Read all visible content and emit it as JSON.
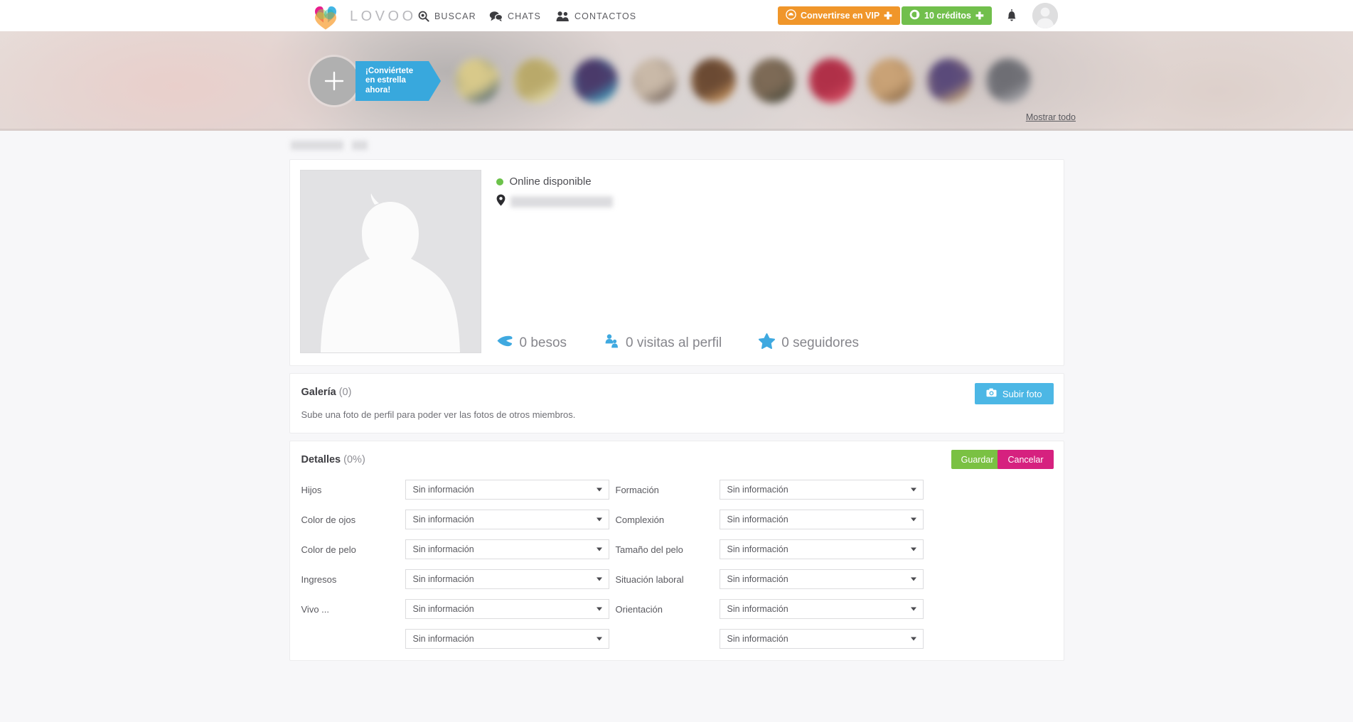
{
  "header": {
    "brand": "LOVOO",
    "nav": [
      {
        "label": "BUSCAR",
        "icon": "search-icon"
      },
      {
        "label": "CHATS",
        "icon": "chat-bubbles-icon"
      },
      {
        "label": "CONTACTOS",
        "icon": "contacts-icon"
      }
    ],
    "vip_button": {
      "label": "Convertirse en VIP",
      "plus": "✚",
      "color": "#f0962a"
    },
    "credits_button": {
      "label": "10 créditos",
      "plus": "✚",
      "color": "#71bf4c",
      "credits": 10
    },
    "bell_icon": "notification-bell-icon",
    "avatar_icon": "user-avatar-placeholder"
  },
  "banner": {
    "star_cta": {
      "line1": "¡Conviértete",
      "line2": "en estrella",
      "line3": "ahora!",
      "plus": "+"
    },
    "show_all_link": "Mostrar todo",
    "avatars": [
      {
        "c1": "#2f4f6e",
        "c2": "#d8c98a"
      },
      {
        "c1": "#efe9c0",
        "c2": "#b9a96a"
      },
      {
        "c1": "#3fbfd8",
        "c2": "#4a3a6a"
      },
      {
        "c1": "#5a4b44",
        "c2": "#c9b9a8"
      },
      {
        "c1": "#e0a86a",
        "c2": "#6b4a33"
      },
      {
        "c1": "#3b4034",
        "c2": "#7d6a56"
      },
      {
        "c1": "#e0566a",
        "c2": "#b03048"
      },
      {
        "c1": "#7a5a3a",
        "c2": "#c9a276"
      },
      {
        "c1": "#e8c37a",
        "c2": "#5a4a7a"
      },
      {
        "c1": "#b9b9bd",
        "c2": "#6e6e74"
      }
    ]
  },
  "profile": {
    "name_redacted": true,
    "age_redacted": true,
    "status": "Online disponible",
    "status_color": "#6cc24a",
    "location_redacted": true,
    "avatar_placeholder": "person-silhouette-icon",
    "stats": [
      {
        "icon": "kiss-lips-icon",
        "label": "0 besos",
        "value": 0
      },
      {
        "icon": "profile-visits-icon",
        "label": "0 visitas al perfil",
        "value": 0
      },
      {
        "icon": "star-icon",
        "label": "0 seguidores",
        "value": 0
      }
    ]
  },
  "gallery": {
    "title": "Galería",
    "count": "(0)",
    "hint": "Sube una foto de perfil para poder ver las fotos de otros miembros.",
    "upload_button": "Subir foto",
    "upload_icon": "camera-icon"
  },
  "details": {
    "title": "Detalles",
    "percent": "(0%)",
    "save_button": "Guardar",
    "cancel_button": "Cancelar",
    "placeholder_value": "Sin información",
    "fields": [
      {
        "label": "Hijos",
        "value": "Sin información"
      },
      {
        "label": "Formación",
        "value": "Sin información"
      },
      {
        "label": "Color de ojos",
        "value": "Sin información"
      },
      {
        "label": "Complexión",
        "value": "Sin información"
      },
      {
        "label": "Color de pelo",
        "value": "Sin información"
      },
      {
        "label": "Tamaño del pelo",
        "value": "Sin información"
      },
      {
        "label": "Ingresos",
        "value": "Sin información"
      },
      {
        "label": "Situación laboral",
        "value": "Sin información"
      },
      {
        "label": "Vivo ...",
        "value": "Sin información"
      },
      {
        "label": "Orientación",
        "value": "Sin información"
      },
      {
        "label": "",
        "value": "Sin información"
      },
      {
        "label": "",
        "value": "Sin información"
      }
    ]
  }
}
